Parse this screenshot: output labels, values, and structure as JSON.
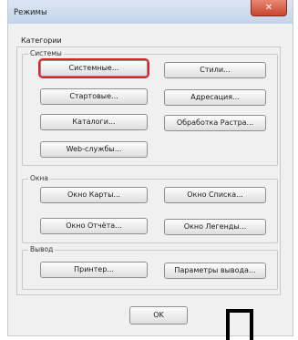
{
  "window": {
    "title": "Режимы",
    "close_symbol": "✕"
  },
  "categories_label": "Категории",
  "systems": {
    "title": "Системы",
    "buttons": {
      "system": "Системные...",
      "styles": "Стили...",
      "startup": "Стартовые...",
      "addressing": "Адресация...",
      "catalogs": "Каталоги...",
      "raster": "Обработка Растра...",
      "web": "Web-службы..."
    }
  },
  "windows": {
    "title": "Окна",
    "buttons": {
      "map": "Окно Карты...",
      "list": "Окно Списка...",
      "report": "Окно Отчёта...",
      "legend": "Окно Легенды..."
    }
  },
  "output": {
    "title": "Вывод",
    "buttons": {
      "printer": "Принтер...",
      "output_params": "Параметры вывода..."
    }
  },
  "footer": {
    "ok": "OK"
  },
  "colors": {
    "highlight": "#e0212a",
    "close_button": "#c8452f"
  }
}
